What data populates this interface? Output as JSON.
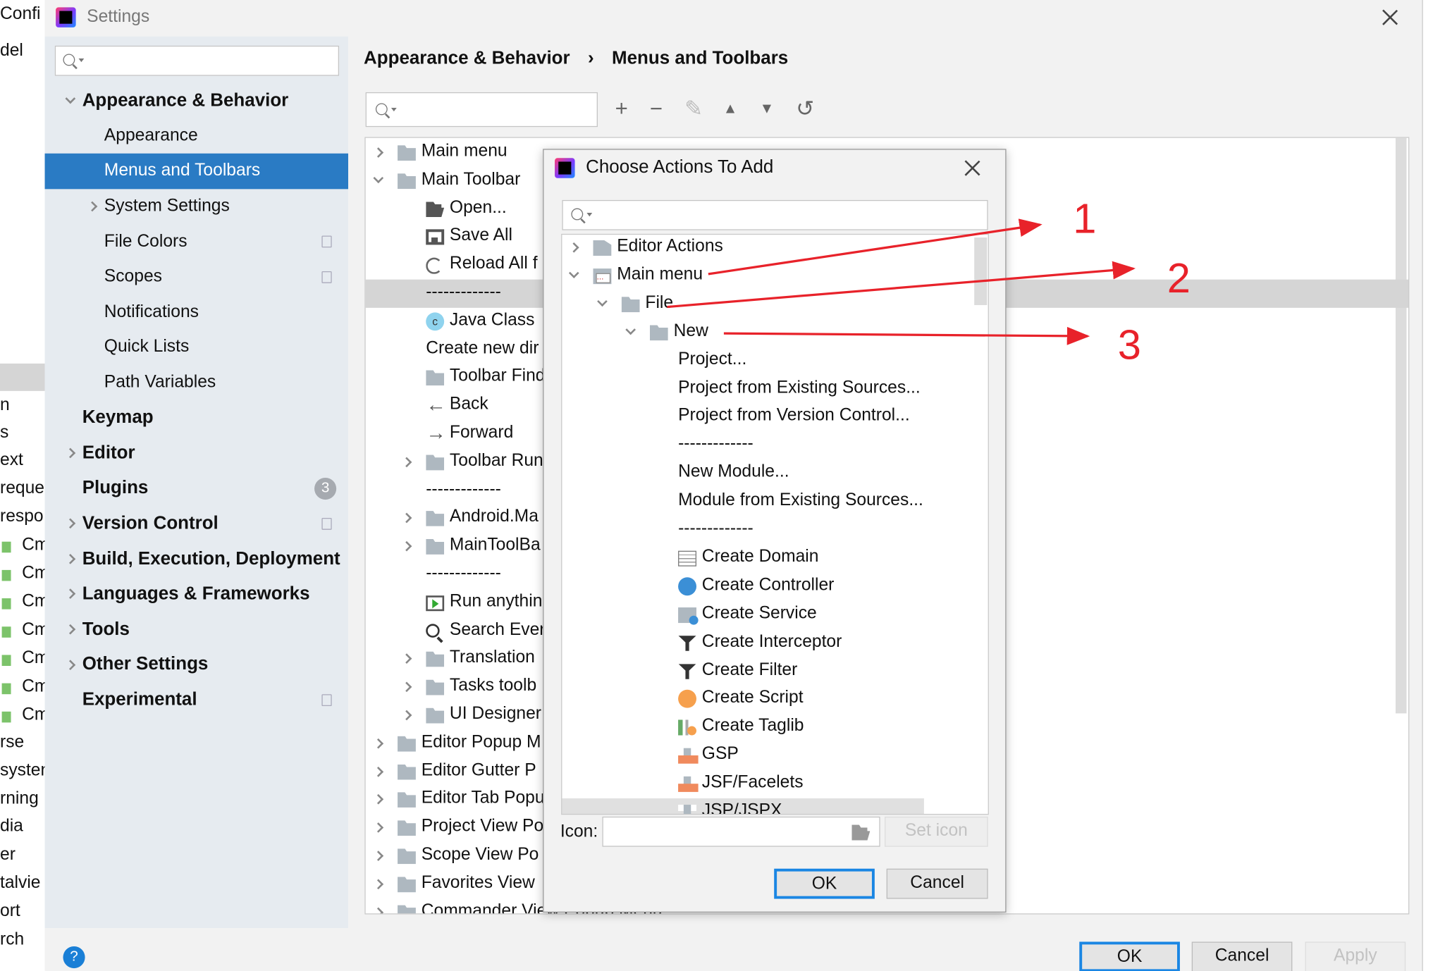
{
  "background_window": {
    "fragments": [
      "Confi",
      "del",
      "n",
      "s",
      "ext",
      "reque",
      "respo",
      "Cm",
      "Cm",
      "Cm",
      "Cm",
      "Cm",
      "Cm",
      "Cm",
      "rse",
      "systen",
      "rning",
      "dia",
      "er",
      "talvie",
      "ort",
      "rch"
    ]
  },
  "settings": {
    "title": "Settings",
    "search_placeholder": "",
    "nav": [
      {
        "label": "Appearance & Behavior",
        "bold": true,
        "level": 0,
        "chevron": "down"
      },
      {
        "label": "Appearance",
        "level": 1
      },
      {
        "label": "Menus and Toolbars",
        "level": 1,
        "selected": true
      },
      {
        "label": "System Settings",
        "level": 1,
        "chevron": "right"
      },
      {
        "label": "File Colors",
        "level": 1,
        "copy": true
      },
      {
        "label": "Scopes",
        "level": 1,
        "copy": true
      },
      {
        "label": "Notifications",
        "level": 1
      },
      {
        "label": "Quick Lists",
        "level": 1
      },
      {
        "label": "Path Variables",
        "level": 1
      },
      {
        "label": "Keymap",
        "bold": true,
        "level": 0
      },
      {
        "label": "Editor",
        "bold": true,
        "level": 0,
        "chevron": "right"
      },
      {
        "label": "Plugins",
        "bold": true,
        "level": 0,
        "badge": "3"
      },
      {
        "label": "Version Control",
        "bold": true,
        "level": 0,
        "chevron": "right",
        "copy": true
      },
      {
        "label": "Build, Execution, Deployment",
        "bold": true,
        "level": 0,
        "chevron": "right"
      },
      {
        "label": "Languages & Frameworks",
        "bold": true,
        "level": 0,
        "chevron": "right"
      },
      {
        "label": "Tools",
        "bold": true,
        "level": 0,
        "chevron": "right"
      },
      {
        "label": "Other Settings",
        "bold": true,
        "level": 0,
        "chevron": "right"
      },
      {
        "label": "Experimental",
        "bold": true,
        "level": 0,
        "copy": true
      }
    ],
    "breadcrumb": [
      "Appearance & Behavior",
      "Menus and Toolbars"
    ],
    "breadcrumb_sep": "›",
    "toolbar": [
      "add-icon",
      "remove-icon",
      "edit-icon",
      "move-up-icon",
      "move-down-icon",
      "restore-icon"
    ],
    "tree": [
      {
        "label": "Main menu",
        "level": 0,
        "icon": "folder",
        "chevron": "right"
      },
      {
        "label": "Main Toolbar",
        "level": 0,
        "icon": "folder",
        "chevron": "down"
      },
      {
        "label": "Open...",
        "level": 1,
        "icon": "ofolder"
      },
      {
        "label": "Save All",
        "level": 1,
        "icon": "save"
      },
      {
        "label": "Reload All f",
        "level": 1,
        "icon": "reload"
      },
      {
        "label": "-------------",
        "level": 1,
        "selected": true
      },
      {
        "label": "Java Class",
        "level": 1,
        "icon": "jclass"
      },
      {
        "label": "Create new dir",
        "level": 1
      },
      {
        "label": "Toolbar Find",
        "level": 1,
        "icon": "folder"
      },
      {
        "label": "Back",
        "level": 1,
        "icon": "back"
      },
      {
        "label": "Forward",
        "level": 1,
        "icon": "forward"
      },
      {
        "label": "Toolbar Run",
        "level": 1,
        "icon": "folder",
        "chevron": "right"
      },
      {
        "label": "-------------",
        "level": 1
      },
      {
        "label": "Android.Ma",
        "level": 1,
        "icon": "folder",
        "chevron": "right"
      },
      {
        "label": "MainToolBa",
        "level": 1,
        "icon": "folder",
        "chevron": "right"
      },
      {
        "label": "-------------",
        "level": 1
      },
      {
        "label": "Run anythin",
        "level": 1,
        "icon": "run"
      },
      {
        "label": "Search Ever",
        "level": 1,
        "icon": "srch"
      },
      {
        "label": "Translation",
        "level": 1,
        "icon": "folder",
        "chevron": "right"
      },
      {
        "label": "Tasks toolb",
        "level": 1,
        "icon": "folder",
        "chevron": "right"
      },
      {
        "label": "UI Designer",
        "level": 1,
        "icon": "folder",
        "chevron": "right"
      },
      {
        "label": "Editor Popup M",
        "level": 0,
        "icon": "folder",
        "chevron": "right"
      },
      {
        "label": "Editor Gutter P",
        "level": 0,
        "icon": "folder",
        "chevron": "right"
      },
      {
        "label": "Editor Tab Popu",
        "level": 0,
        "icon": "folder",
        "chevron": "right"
      },
      {
        "label": "Project View Po",
        "level": 0,
        "icon": "folder",
        "chevron": "right"
      },
      {
        "label": "Scope View Po",
        "level": 0,
        "icon": "folder",
        "chevron": "right"
      },
      {
        "label": "Favorites View",
        "level": 0,
        "icon": "folder",
        "chevron": "right"
      },
      {
        "label": "Commander View Popup Menu",
        "level": 0,
        "icon": "folder",
        "chevron": "right"
      }
    ],
    "buttons": {
      "ok": "OK",
      "cancel": "Cancel",
      "apply": "Apply",
      "help": "?"
    }
  },
  "dialog": {
    "title": "Choose Actions To Add",
    "search_placeholder": "",
    "tree": [
      {
        "label": "Editor Actions",
        "level": 0,
        "icon": "editoract",
        "chevron": "right"
      },
      {
        "label": "Main menu",
        "level": 0,
        "icon": "mainmenu",
        "chevron": "down"
      },
      {
        "label": "File",
        "level": 1,
        "icon": "folder",
        "chevron": "down"
      },
      {
        "label": "New",
        "level": 2,
        "icon": "folder",
        "chevron": "down"
      },
      {
        "label": "Project...",
        "level": 3
      },
      {
        "label": "Project from Existing Sources...",
        "level": 3
      },
      {
        "label": "Project from Version Control...",
        "level": 3
      },
      {
        "label": "-------------",
        "level": 3
      },
      {
        "label": "New Module...",
        "level": 3
      },
      {
        "label": "Module from Existing Sources...",
        "level": 3
      },
      {
        "label": "-------------",
        "level": 3
      },
      {
        "label": "Create Domain",
        "level": 3,
        "icon": "table"
      },
      {
        "label": "Create Controller",
        "level": 3,
        "icon": "wrench"
      },
      {
        "label": "Create Service",
        "level": 3,
        "icon": "service"
      },
      {
        "label": "Create Interceptor",
        "level": 3,
        "icon": "filter"
      },
      {
        "label": "Create Filter",
        "level": 3,
        "icon": "filter"
      },
      {
        "label": "Create Script",
        "level": 3,
        "icon": "script"
      },
      {
        "label": "Create Taglib",
        "level": 3,
        "icon": "taglib"
      },
      {
        "label": "GSP",
        "level": 3,
        "icon": "gsp"
      },
      {
        "label": "JSF/Facelets",
        "level": 3,
        "icon": "jsf"
      },
      {
        "label": "JSP/JSPX",
        "level": 3,
        "icon": "jsp",
        "selected": true
      }
    ],
    "icon_label": "Icon:",
    "icon_value": "",
    "set_icon": "Set icon",
    "ok": "OK",
    "cancel": "Cancel"
  },
  "annotations": {
    "color": "#e8222a",
    "labels": [
      "1",
      "2",
      "3"
    ]
  }
}
